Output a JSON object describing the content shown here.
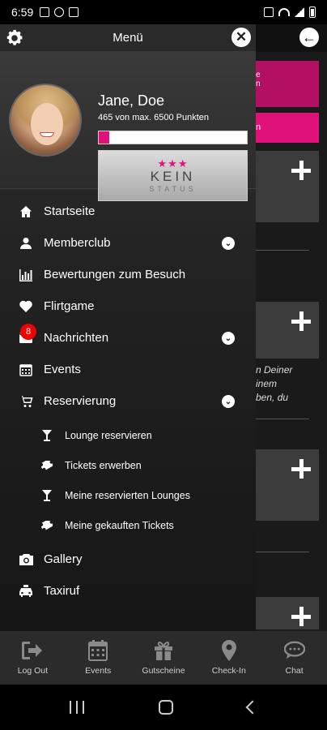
{
  "status_bar": {
    "time": "6:59"
  },
  "drawer": {
    "title": "Menü",
    "icons": {
      "settings": "gear-icon",
      "close": "close-icon"
    },
    "profile": {
      "name": "Jane, Doe",
      "points_text": "465  von max. 6500 Punkten",
      "progress_fraction": 0.0715,
      "status_line1": "KEIN",
      "status_line2": "STATUS",
      "stars": "★★★"
    },
    "menu": [
      {
        "label": "Startseite",
        "icon": "home-icon"
      },
      {
        "label": "Memberclub",
        "icon": "user-icon",
        "expandable": true
      },
      {
        "label": "Bewertungen zum Besuch",
        "icon": "bar-chart-icon"
      },
      {
        "label": "Flirtgame",
        "icon": "heart-icon"
      },
      {
        "label": "Nachrichten",
        "icon": "mail-icon",
        "expandable": true,
        "badge": "8"
      },
      {
        "label": "Events",
        "icon": "calendar-icon"
      },
      {
        "label": "Reservierung",
        "icon": "cart-icon",
        "expandable": true
      }
    ],
    "submenu": [
      {
        "label": "Lounge reservieren",
        "icon": "cocktail-icon"
      },
      {
        "label": "Tickets erwerben",
        "icon": "ticket-icon"
      },
      {
        "label": "Meine reservierten Lounges",
        "icon": "cocktail-icon"
      },
      {
        "label": "Meine gekauften Tickets",
        "icon": "ticket-icon"
      }
    ],
    "menu_bottom": [
      {
        "label": "Gallery",
        "icon": "camera-icon"
      },
      {
        "label": "Taxiruf",
        "icon": "taxi-icon"
      }
    ]
  },
  "background": {
    "pink_card_text": "e\nn",
    "pink_button_text": "n",
    "italic_text": "n Deiner\ninem\nben, du"
  },
  "tabbar": [
    {
      "label": "Log Out",
      "icon": "logout-icon"
    },
    {
      "label": "Events",
      "icon": "calendar-icon"
    },
    {
      "label": "Gutscheine",
      "icon": "gift-icon"
    },
    {
      "label": "Check-In",
      "icon": "location-pin-icon"
    },
    {
      "label": "Chat",
      "icon": "chat-icon"
    }
  ],
  "colors": {
    "accent": "#e0127a",
    "badge": "#f00000",
    "drawer_bg": "#2a2a2a"
  }
}
